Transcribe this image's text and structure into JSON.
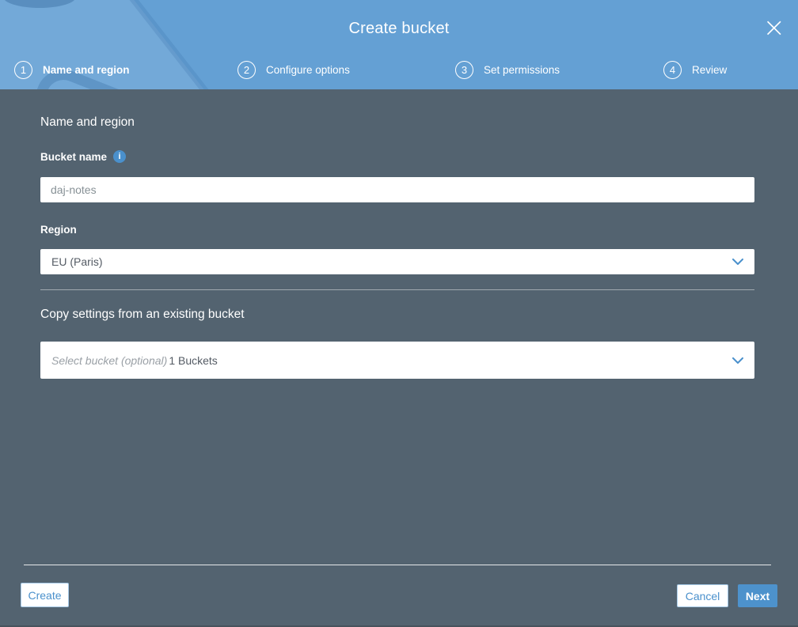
{
  "header": {
    "title": "Create bucket",
    "close_icon": "×"
  },
  "steps": [
    {
      "number": "1",
      "label": "Name and region",
      "active": true
    },
    {
      "number": "2",
      "label": "Configure options",
      "active": false
    },
    {
      "number": "3",
      "label": "Set permissions",
      "active": false
    },
    {
      "number": "4",
      "label": "Review",
      "active": false
    }
  ],
  "form": {
    "section_title": "Name and region",
    "bucket_name": {
      "label": "Bucket name",
      "value": "daj-notes",
      "info_icon": "i"
    },
    "region": {
      "label": "Region",
      "value": "EU (Paris)"
    },
    "copy_settings": {
      "title": "Copy settings from an existing bucket",
      "placeholder": "Select bucket (optional)",
      "bucket_count": "1 Buckets"
    }
  },
  "footer": {
    "create_label": "Create",
    "cancel_label": "Cancel",
    "next_label": "Next"
  },
  "colors": {
    "header_blue": "#64a0d4",
    "body_bg": "#536370",
    "accent_blue": "#4a90cc",
    "next_button_bg": "#4d92cc",
    "input_text_gray": "#879196",
    "select_text_dark": "#545b64"
  }
}
